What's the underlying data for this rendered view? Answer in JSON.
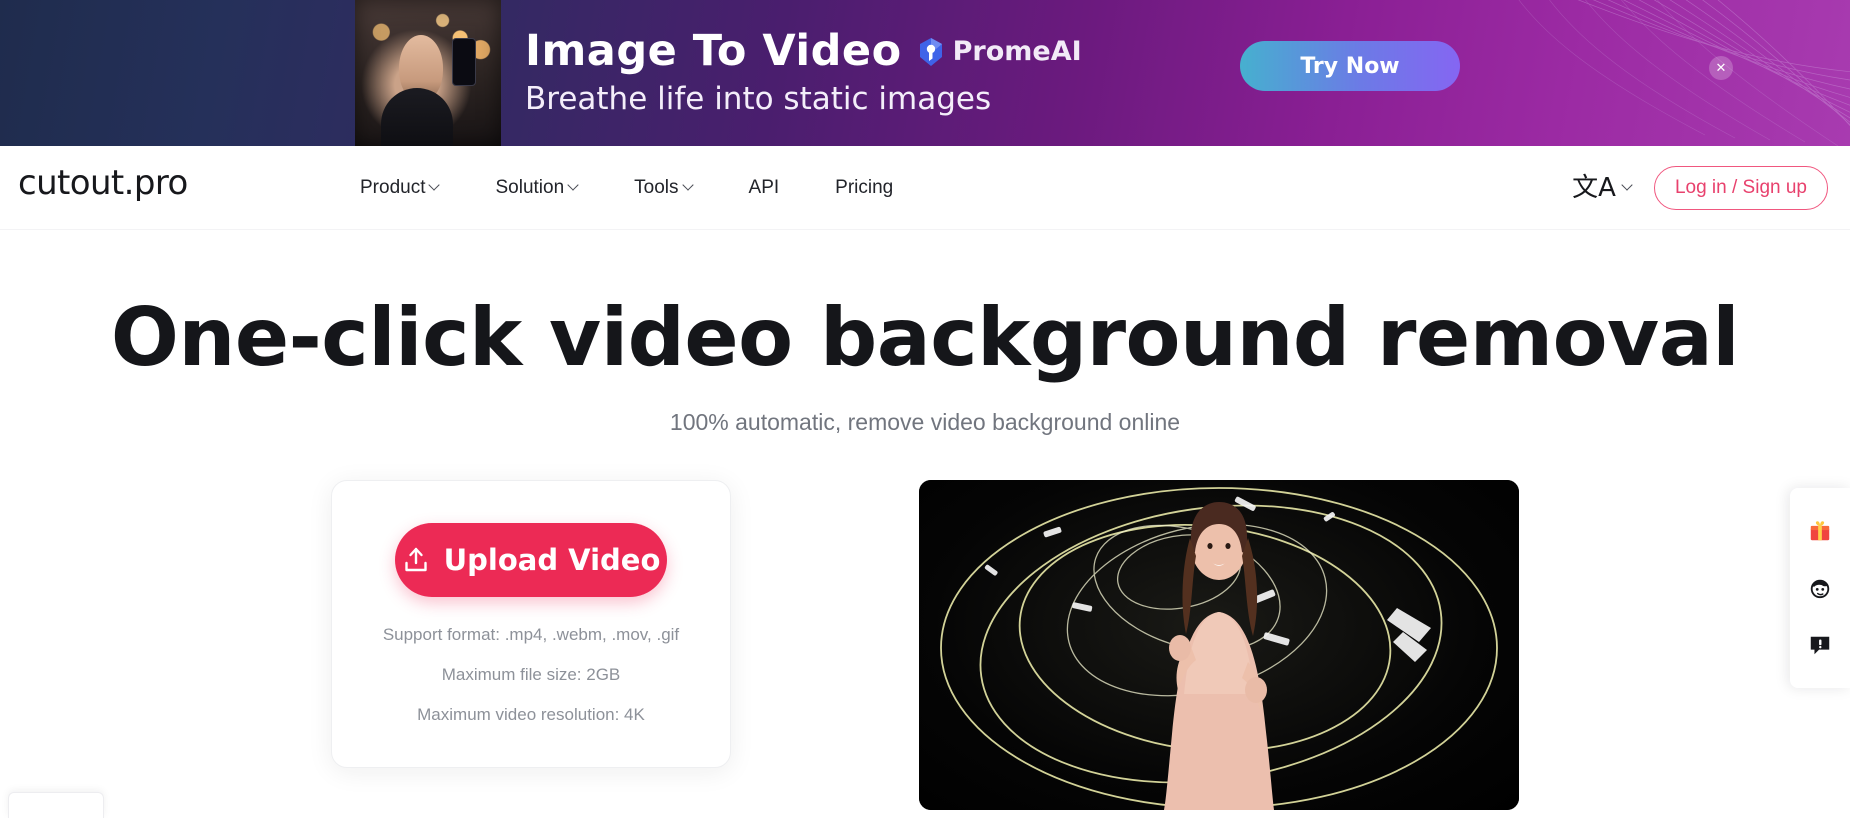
{
  "ad": {
    "title": "Image To Video",
    "brand": "PromeAI",
    "subtitle": "Breathe life into static images",
    "cta_label": "Try Now",
    "close_label": "✕",
    "brand_icon": "promeai-logo-icon",
    "thumb_alt": "woman-taking-selfie-thumbnail"
  },
  "nav": {
    "logo": "cutout.pro",
    "items": [
      {
        "label": "Product",
        "has_dropdown": true
      },
      {
        "label": "Solution",
        "has_dropdown": true
      },
      {
        "label": "Tools",
        "has_dropdown": true
      },
      {
        "label": "API",
        "has_dropdown": false
      },
      {
        "label": "Pricing",
        "has_dropdown": false
      }
    ],
    "language_glyph": "文A",
    "login_label": "Log in / Sign up"
  },
  "hero": {
    "title": "One-click video background removal",
    "subtitle": "100% automatic, remove video background online"
  },
  "upload": {
    "button_label": "Upload Video",
    "button_icon": "upload-icon",
    "notes": [
      "Support format: .mp4, .webm, .mov, .gif",
      "Maximum file size: 2GB",
      "Maximum video resolution: 4K"
    ]
  },
  "preview": {
    "alt": "woman-in-pink-dress-video-preview"
  },
  "dock": {
    "items": [
      {
        "icon": "gift-icon"
      },
      {
        "icon": "customer-service-face-icon"
      },
      {
        "icon": "feedback-icon"
      }
    ]
  },
  "colors": {
    "accent_pink": "#ec2a55",
    "login_border": "#f0577f",
    "ad_gradient_start": "#1f2c4d",
    "ad_gradient_end": "#a83bb0",
    "cta_gradient_start": "#46b0cf",
    "cta_gradient_end": "#8566f2"
  }
}
